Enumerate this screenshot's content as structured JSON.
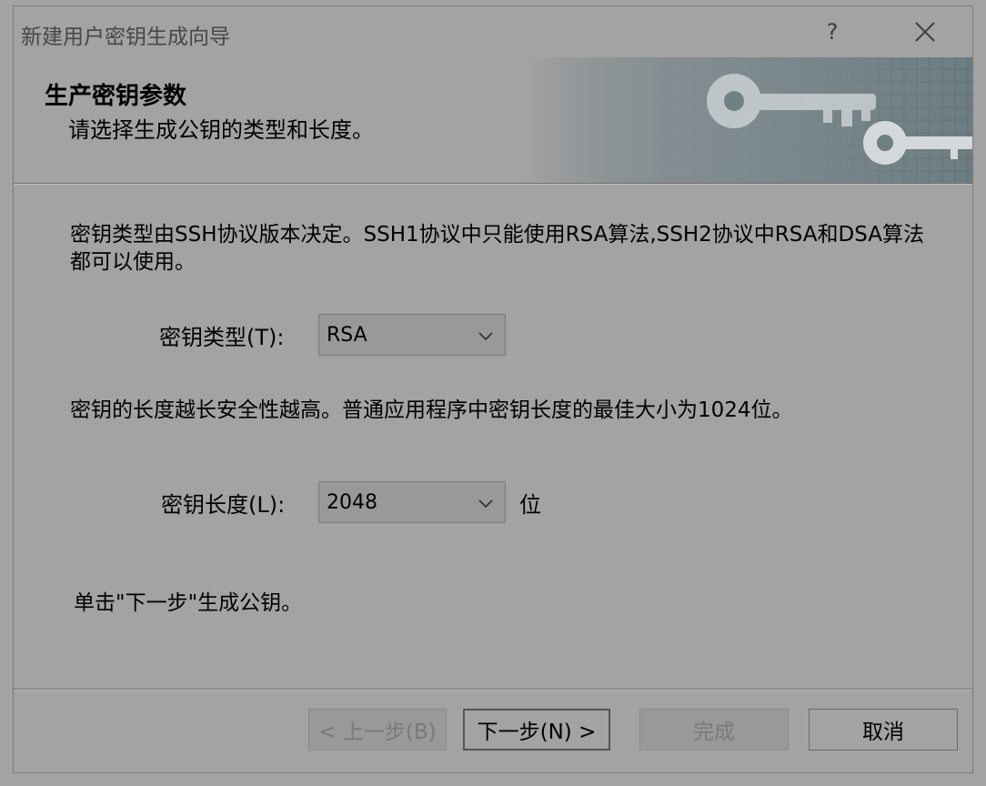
{
  "window": {
    "title": "新建用户密钥生成向导",
    "help_label": "?",
    "close_icon": "close-icon"
  },
  "header": {
    "title": "生产密钥参数",
    "subtitle": "请选择生成公钥的类型和长度。",
    "banner_icon": "key-icon"
  },
  "content": {
    "description_type": "密钥类型由SSH协议版本决定。SSH1协议中只能使用RSA算法,SSH2协议中RSA和DSA算法都可以使用。",
    "key_type_label": "密钥类型(T):",
    "key_type_value": "RSA",
    "description_length": "密钥的长度越长安全性越高。普通应用程序中密钥长度的最佳大小为1024位。",
    "key_length_label": "密钥长度(L):",
    "key_length_value": "2048",
    "key_length_unit": "位",
    "instruction": "单击\"下一步\"生成公钥。"
  },
  "buttons": {
    "back": "< 上一步(B)",
    "next": "下一步(N) >",
    "finish": "完成",
    "cancel": "取消"
  }
}
